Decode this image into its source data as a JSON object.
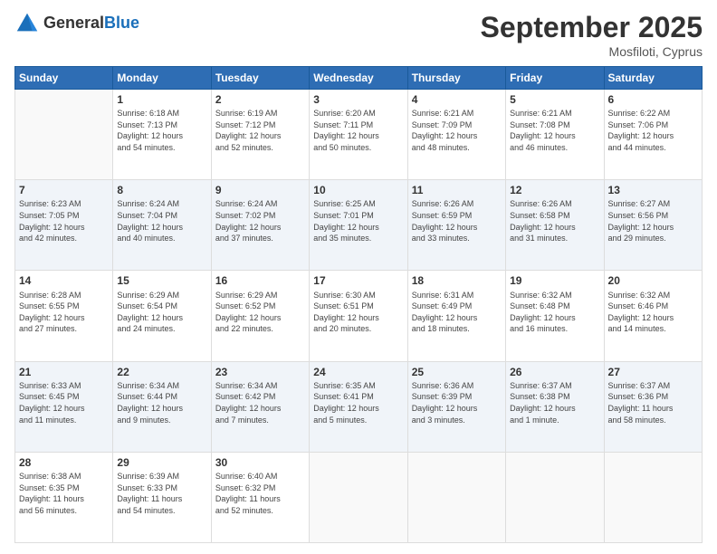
{
  "logo": {
    "general": "General",
    "blue": "Blue"
  },
  "title": "September 2025",
  "location": "Mosfiloti, Cyprus",
  "days_of_week": [
    "Sunday",
    "Monday",
    "Tuesday",
    "Wednesday",
    "Thursday",
    "Friday",
    "Saturday"
  ],
  "weeks": [
    [
      {
        "num": "",
        "info": ""
      },
      {
        "num": "1",
        "info": "Sunrise: 6:18 AM\nSunset: 7:13 PM\nDaylight: 12 hours\nand 54 minutes."
      },
      {
        "num": "2",
        "info": "Sunrise: 6:19 AM\nSunset: 7:12 PM\nDaylight: 12 hours\nand 52 minutes."
      },
      {
        "num": "3",
        "info": "Sunrise: 6:20 AM\nSunset: 7:11 PM\nDaylight: 12 hours\nand 50 minutes."
      },
      {
        "num": "4",
        "info": "Sunrise: 6:21 AM\nSunset: 7:09 PM\nDaylight: 12 hours\nand 48 minutes."
      },
      {
        "num": "5",
        "info": "Sunrise: 6:21 AM\nSunset: 7:08 PM\nDaylight: 12 hours\nand 46 minutes."
      },
      {
        "num": "6",
        "info": "Sunrise: 6:22 AM\nSunset: 7:06 PM\nDaylight: 12 hours\nand 44 minutes."
      }
    ],
    [
      {
        "num": "7",
        "info": "Sunrise: 6:23 AM\nSunset: 7:05 PM\nDaylight: 12 hours\nand 42 minutes."
      },
      {
        "num": "8",
        "info": "Sunrise: 6:24 AM\nSunset: 7:04 PM\nDaylight: 12 hours\nand 40 minutes."
      },
      {
        "num": "9",
        "info": "Sunrise: 6:24 AM\nSunset: 7:02 PM\nDaylight: 12 hours\nand 37 minutes."
      },
      {
        "num": "10",
        "info": "Sunrise: 6:25 AM\nSunset: 7:01 PM\nDaylight: 12 hours\nand 35 minutes."
      },
      {
        "num": "11",
        "info": "Sunrise: 6:26 AM\nSunset: 6:59 PM\nDaylight: 12 hours\nand 33 minutes."
      },
      {
        "num": "12",
        "info": "Sunrise: 6:26 AM\nSunset: 6:58 PM\nDaylight: 12 hours\nand 31 minutes."
      },
      {
        "num": "13",
        "info": "Sunrise: 6:27 AM\nSunset: 6:56 PM\nDaylight: 12 hours\nand 29 minutes."
      }
    ],
    [
      {
        "num": "14",
        "info": "Sunrise: 6:28 AM\nSunset: 6:55 PM\nDaylight: 12 hours\nand 27 minutes."
      },
      {
        "num": "15",
        "info": "Sunrise: 6:29 AM\nSunset: 6:54 PM\nDaylight: 12 hours\nand 24 minutes."
      },
      {
        "num": "16",
        "info": "Sunrise: 6:29 AM\nSunset: 6:52 PM\nDaylight: 12 hours\nand 22 minutes."
      },
      {
        "num": "17",
        "info": "Sunrise: 6:30 AM\nSunset: 6:51 PM\nDaylight: 12 hours\nand 20 minutes."
      },
      {
        "num": "18",
        "info": "Sunrise: 6:31 AM\nSunset: 6:49 PM\nDaylight: 12 hours\nand 18 minutes."
      },
      {
        "num": "19",
        "info": "Sunrise: 6:32 AM\nSunset: 6:48 PM\nDaylight: 12 hours\nand 16 minutes."
      },
      {
        "num": "20",
        "info": "Sunrise: 6:32 AM\nSunset: 6:46 PM\nDaylight: 12 hours\nand 14 minutes."
      }
    ],
    [
      {
        "num": "21",
        "info": "Sunrise: 6:33 AM\nSunset: 6:45 PM\nDaylight: 12 hours\nand 11 minutes."
      },
      {
        "num": "22",
        "info": "Sunrise: 6:34 AM\nSunset: 6:44 PM\nDaylight: 12 hours\nand 9 minutes."
      },
      {
        "num": "23",
        "info": "Sunrise: 6:34 AM\nSunset: 6:42 PM\nDaylight: 12 hours\nand 7 minutes."
      },
      {
        "num": "24",
        "info": "Sunrise: 6:35 AM\nSunset: 6:41 PM\nDaylight: 12 hours\nand 5 minutes."
      },
      {
        "num": "25",
        "info": "Sunrise: 6:36 AM\nSunset: 6:39 PM\nDaylight: 12 hours\nand 3 minutes."
      },
      {
        "num": "26",
        "info": "Sunrise: 6:37 AM\nSunset: 6:38 PM\nDaylight: 12 hours\nand 1 minute."
      },
      {
        "num": "27",
        "info": "Sunrise: 6:37 AM\nSunset: 6:36 PM\nDaylight: 11 hours\nand 58 minutes."
      }
    ],
    [
      {
        "num": "28",
        "info": "Sunrise: 6:38 AM\nSunset: 6:35 PM\nDaylight: 11 hours\nand 56 minutes."
      },
      {
        "num": "29",
        "info": "Sunrise: 6:39 AM\nSunset: 6:33 PM\nDaylight: 11 hours\nand 54 minutes."
      },
      {
        "num": "30",
        "info": "Sunrise: 6:40 AM\nSunset: 6:32 PM\nDaylight: 11 hours\nand 52 minutes."
      },
      {
        "num": "",
        "info": ""
      },
      {
        "num": "",
        "info": ""
      },
      {
        "num": "",
        "info": ""
      },
      {
        "num": "",
        "info": ""
      }
    ]
  ]
}
